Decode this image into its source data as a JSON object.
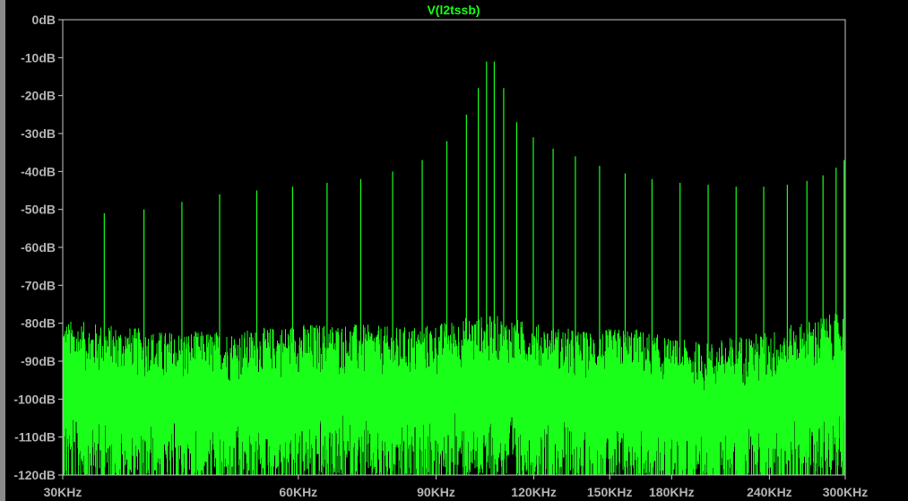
{
  "chart_data": {
    "type": "line",
    "title": "V(l2tssb)",
    "xlabel": "",
    "ylabel": "",
    "x_scale": "log",
    "xlim_khz": [
      30,
      300
    ],
    "ylim": [
      -120,
      0
    ],
    "y_ticks": [
      "0dB",
      "-10dB",
      "-20dB",
      "-30dB",
      "-40dB",
      "-50dB",
      "-60dB",
      "-70dB",
      "-80dB",
      "-90dB",
      "-100dB",
      "-110dB",
      "-120dB"
    ],
    "y_tick_values": [
      0,
      -10,
      -20,
      -30,
      -40,
      -50,
      -60,
      -70,
      -80,
      -90,
      -100,
      -110,
      -120
    ],
    "x_ticks": [
      "30KHz",
      "60KHz",
      "90KHz",
      "120KHz",
      "150KHz",
      "180KHz",
      "240KHz",
      "300KHz"
    ],
    "x_tick_values_khz": [
      30,
      60,
      90,
      120,
      150,
      180,
      240,
      300
    ],
    "series": [
      {
        "color": "#19ff19",
        "spectral_lines_khz_db": [
          [
            33.9,
            -51
          ],
          [
            38.1,
            -50
          ],
          [
            42.6,
            -48
          ],
          [
            47.6,
            -46
          ],
          [
            53.1,
            -45
          ],
          [
            59,
            -44
          ],
          [
            65.3,
            -43
          ],
          [
            72.1,
            -42
          ],
          [
            79.2,
            -40
          ],
          [
            86.4,
            -37
          ],
          [
            92.9,
            -32
          ],
          [
            98.4,
            -25
          ],
          [
            101.9,
            -18
          ],
          [
            104.4,
            -11
          ],
          [
            106.8,
            -11
          ],
          [
            109.8,
            -18
          ],
          [
            114.1,
            -27
          ],
          [
            119.8,
            -31
          ],
          [
            127,
            -34
          ],
          [
            135.6,
            -36
          ],
          [
            145.6,
            -38.5
          ],
          [
            157,
            -40.5
          ],
          [
            169.9,
            -42
          ],
          [
            184.5,
            -43
          ],
          [
            200.4,
            -43.5
          ],
          [
            217.6,
            -44
          ],
          [
            236,
            -44
          ],
          [
            253,
            -43.5
          ],
          [
            268,
            -42.5
          ],
          [
            281,
            -41
          ],
          [
            292,
            -39
          ],
          [
            299,
            -37
          ]
        ],
        "noise_floor_db": [
          [
            30,
            -97
          ],
          [
            40,
            -100
          ],
          [
            50,
            -100
          ],
          [
            60,
            -98
          ],
          [
            70,
            -98
          ],
          [
            80,
            -99
          ],
          [
            90,
            -98
          ],
          [
            100,
            -96
          ],
          [
            110,
            -96
          ],
          [
            120,
            -98
          ],
          [
            140,
            -100
          ],
          [
            160,
            -99
          ],
          [
            180,
            -102
          ],
          [
            200,
            -103
          ],
          [
            220,
            -101
          ],
          [
            240,
            -100
          ],
          [
            260,
            -98
          ],
          [
            280,
            -96
          ],
          [
            300,
            -95
          ]
        ]
      }
    ],
    "grid": false,
    "legend": "none"
  }
}
